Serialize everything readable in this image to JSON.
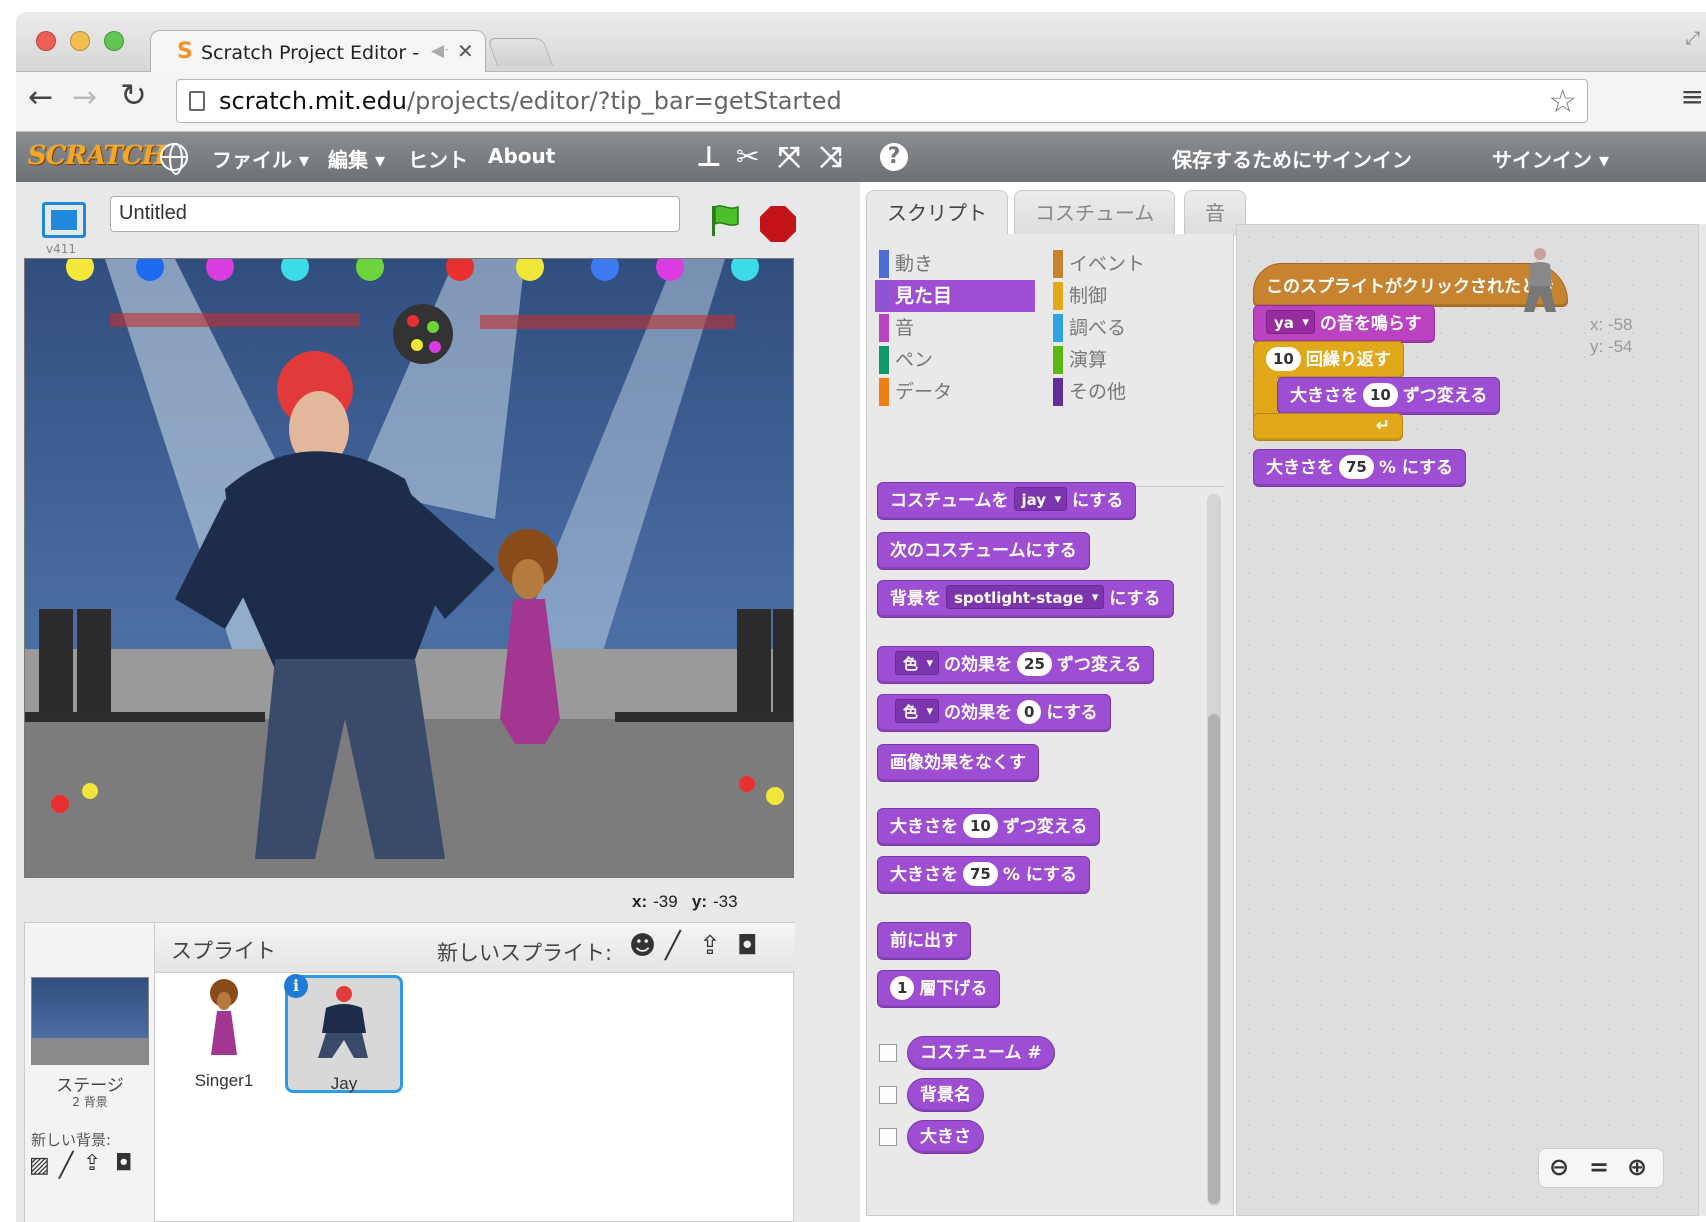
{
  "browser": {
    "tab_title": "Scratch Project Editor -",
    "favicon_letter": "S",
    "url_host": "scratch.mit.edu",
    "url_path": "/projects/editor/?tip_bar=getStarted"
  },
  "menubar": {
    "logo": "SCRATCH",
    "file": "ファイル ▾",
    "edit": "編集 ▾",
    "tips": "ヒント",
    "about": "About",
    "save_signin": "保存するためにサインイン",
    "signin": "サインイン ▾"
  },
  "stage": {
    "version": "v411",
    "project_title": "Untitled",
    "coords": {
      "x_label": "x:",
      "x": "-39",
      "y_label": "y:",
      "y": "-33"
    }
  },
  "sprites": {
    "header": "スプライト",
    "new_sprite": "新しいスプライト:",
    "stage_label": "ステージ",
    "stage_sub": "2 背景",
    "new_backdrop": "新しい背景:",
    "items": [
      {
        "name": "Singer1",
        "selected": false
      },
      {
        "name": "Jay",
        "selected": true
      }
    ]
  },
  "editor_tabs": [
    "スクリプト",
    "コスチューム",
    "音"
  ],
  "categories": [
    {
      "label": "動き",
      "color": "#4a6cd4"
    },
    {
      "label": "見た目",
      "color": "#8a55d7",
      "active": true
    },
    {
      "label": "音",
      "color": "#bb42c3"
    },
    {
      "label": "ペン",
      "color": "#0e9a6c"
    },
    {
      "label": "データ",
      "color": "#ee7d16"
    },
    {
      "label": "イベント",
      "color": "#c88330"
    },
    {
      "label": "制御",
      "color": "#e1a91a"
    },
    {
      "label": "調べる",
      "color": "#2ca5e2"
    },
    {
      "label": "演算",
      "color": "#5cb712"
    },
    {
      "label": "その他",
      "color": "#632d99"
    }
  ],
  "palette": {
    "switch_costume": {
      "pre": "コスチュームを",
      "slot": "jay",
      "post": "にする"
    },
    "next_costume": "次のコスチュームにする",
    "switch_backdrop": {
      "pre": "背景を",
      "slot": "spotlight-stage",
      "post": "にする"
    },
    "change_effect": {
      "slot": "色",
      "mid": "の効果を",
      "num": "25",
      "post": "ずつ変える"
    },
    "set_effect": {
      "slot": "色",
      "mid": "の効果を",
      "num": "0",
      "post": "にする"
    },
    "clear_effects": "画像効果をなくす",
    "change_size": {
      "pre": "大きさを",
      "num": "10",
      "post": "ずつ変える"
    },
    "set_size": {
      "pre": "大きさを",
      "num": "75",
      "post": "% にする"
    },
    "go_front": "前に出す",
    "go_back": {
      "num": "1",
      "post": "層下げる"
    },
    "costume_num": "コスチューム #",
    "backdrop_name": "背景名",
    "size": "大きさ"
  },
  "script": {
    "hat": "このスプライトがクリックされたとき",
    "play_sound": {
      "slot": "ya",
      "post": "の音を鳴らす"
    },
    "repeat": {
      "num": "10",
      "post": "回繰り返す"
    },
    "change_size": {
      "pre": "大きさを",
      "num": "10",
      "post": "ずつ変える"
    },
    "set_size": {
      "pre": "大きさを",
      "num": "75",
      "post": "% にする"
    }
  },
  "canvas": {
    "x": "x: -58",
    "y": "y: -54"
  }
}
